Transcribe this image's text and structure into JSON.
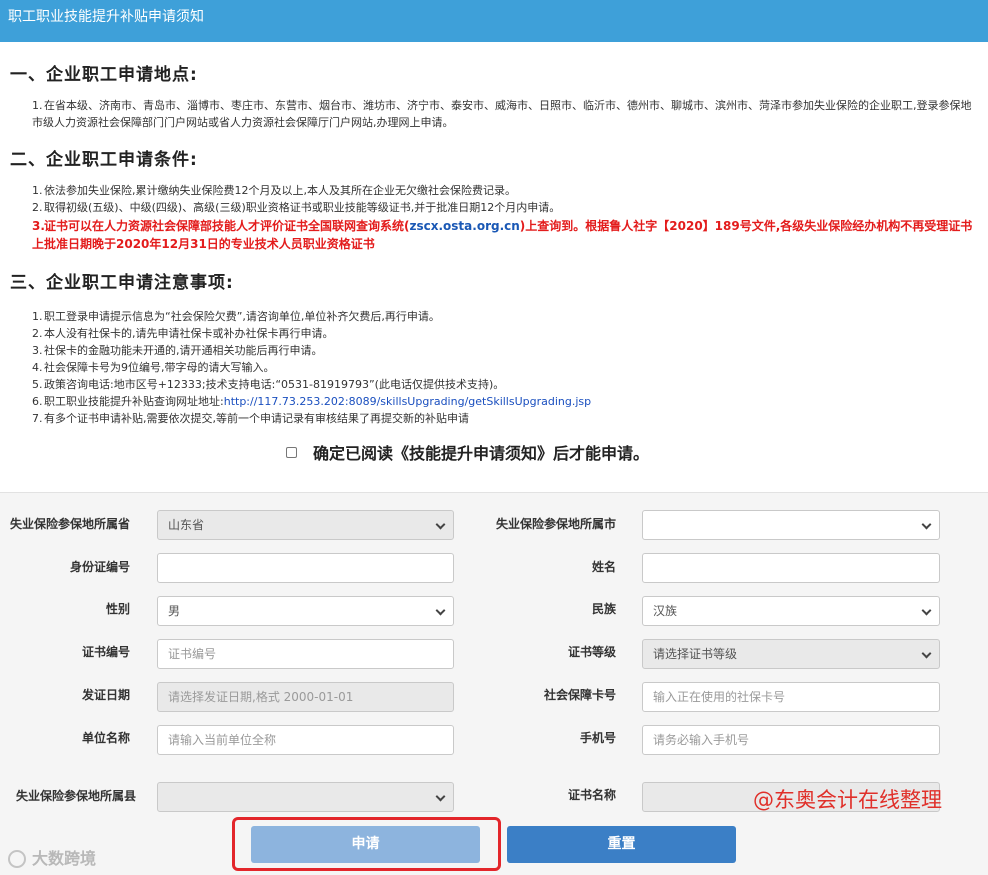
{
  "header": {
    "title": "职工职业技能提升补贴申请须知"
  },
  "sections": [
    {
      "title": "一、企业职工申请地点:",
      "items": [
        {
          "num": "1.",
          "text": "在省本级、济南市、青岛市、淄博市、枣庄市、东营市、烟台市、潍坊市、济宁市、泰安市、威海市、日照市、临沂市、德州市、聊城市、滨州市、菏泽市参加失业保险的企业职工,登录参保地市级人力资源社会保障部门门户网站或省人力资源社会保障厅门户网站,办理网上申请。"
        }
      ]
    },
    {
      "title": "二、企业职工申请条件:",
      "items": [
        {
          "num": "1.",
          "text": "依法参加失业保险,累计缴纳失业保险费12个月及以上,本人及其所在企业无欠缴社会保险费记录。"
        },
        {
          "num": "2.",
          "text": "取得初级(五级)、中级(四级)、高级(三级)职业资格证书或职业技能等级证书,并于批准日期12个月内申请。"
        },
        {
          "num": "3.",
          "text_a": "证书可以在人力资源社会保障部技能人才评价证书全国联网查询系统(",
          "site": "zscx.osta.org.cn",
          "text_b": ")上查询到。根据鲁人社字【2020】189号文件,各级失业保险经办机构不再受理证书上批准日期晚于2020年12月31日的专业技术人员职业资格证书"
        }
      ]
    },
    {
      "title": "三、企业职工申请注意事项:",
      "items": [
        {
          "num": "1.",
          "text": "职工登录申请提示信息为“社会保险欠费”,请咨询单位,单位补齐欠费后,再行申请。"
        },
        {
          "num": "2.",
          "text": "本人没有社保卡的,请先申请社保卡或补办社保卡再行申请。"
        },
        {
          "num": "3.",
          "text": "社保卡的金融功能未开通的,请开通相关功能后再行申请。"
        },
        {
          "num": "4.",
          "text": "社会保障卡号为9位编号,带字母的请大写输入。"
        },
        {
          "num": "5.",
          "text": "政策咨询电话:地市区号+12333;技术支持电话:“0531-81919793”(此电话仅提供技术支持)。"
        },
        {
          "num": "6.",
          "text": "职工职业技能提升补贴查询网址地址:",
          "link": "http://117.73.253.202:8089/skillsUpgrading/getSkillsUpgrading.jsp"
        },
        {
          "num": "7.",
          "text": "有多个证书申请补贴,需要依次提交,等前一个申请记录有审核结果了再提交新的补贴申请"
        }
      ]
    }
  ],
  "confirm": {
    "label": "确定已阅读《技能提升申请须知》后才能申请。"
  },
  "form": {
    "province_label": "失业保险参保地所属省",
    "province_value": "山东省",
    "city_label": "失业保险参保地所属市",
    "city_value": "",
    "idcard_label": "身份证编号",
    "idcard_value": "",
    "name_label": "姓名",
    "name_value": "",
    "gender_label": "性别",
    "gender_value": "男",
    "ethnicity_label": "民族",
    "ethnicity_value": "汉族",
    "certno_label": "证书编号",
    "certno_placeholder": "证书编号",
    "certlevel_label": "证书等级",
    "certlevel_value": "请选择证书等级",
    "issuedate_label": "发证日期",
    "issuedate_placeholder": "请选择发证日期,格式 2000-01-01",
    "sscard_label": "社会保障卡号",
    "sscard_placeholder": "输入正在使用的社保卡号",
    "employer_label": "单位名称",
    "employer_placeholder": "请输入当前单位全称",
    "phone_label": "手机号",
    "phone_placeholder": "请务必输入手机号",
    "county_label": "失业保险参保地所属县",
    "county_value": "",
    "certname_label": "证书名称",
    "certname_value": ""
  },
  "buttons": {
    "apply": "申请",
    "reset": "重置"
  },
  "watermarks": {
    "right": "@东奥会计在线整理",
    "left": "大数跨境"
  },
  "colors": {
    "header_bg": "#3ea0d9",
    "highlight_red": "#e31c1c",
    "apply_bg": "#8db4de",
    "reset_bg": "#3b7fc6"
  }
}
